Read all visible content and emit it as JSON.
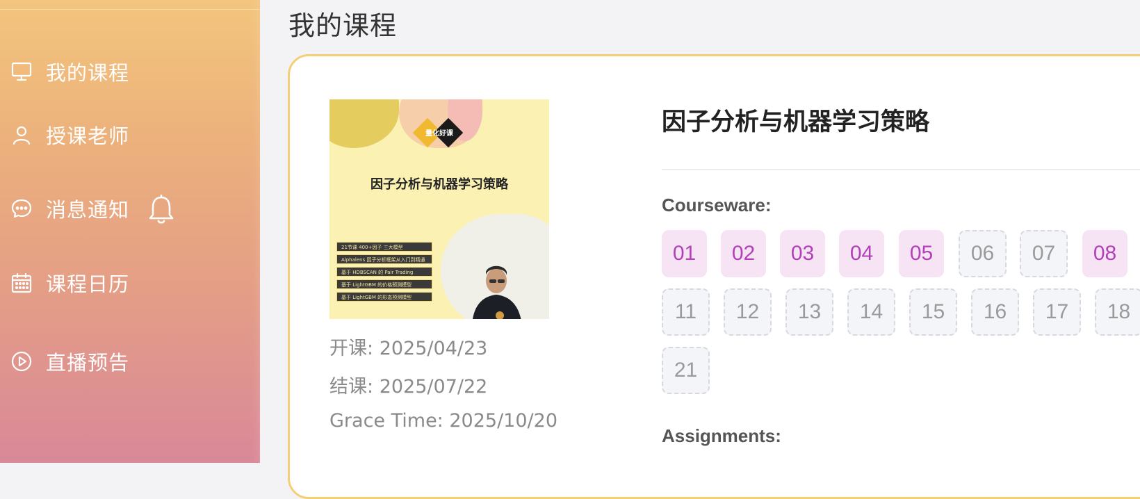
{
  "sidebar": {
    "items": [
      {
        "label": "我的课程",
        "icon": "monitor-icon"
      },
      {
        "label": "授课老师",
        "icon": "user-icon"
      },
      {
        "label": "消息通知",
        "icon": "chat-icon",
        "badge_icon": "bell-icon"
      },
      {
        "label": "课程日历",
        "icon": "calendar-icon"
      },
      {
        "label": "直播预告",
        "icon": "play-circle-icon"
      }
    ]
  },
  "page": {
    "title": "我的课程"
  },
  "course": {
    "title": "因子分析与机器学习策略",
    "cover": {
      "brand": "量化好课",
      "title": "因子分析与机器学习策略",
      "tags": [
        "21节课 400+因子 三大模型",
        "Alphalens 因子分析框架从入门到精通",
        "基于 HDBSCAN 的 Pair Trading",
        "基于 LightGBM 的价格预测模型",
        "基于 LightGBM 的形态预测模型"
      ]
    },
    "start": {
      "label": "开课:",
      "value": "2025/04/23"
    },
    "end": {
      "label": "结课:",
      "value": "2025/07/22"
    },
    "grace": {
      "label": "Grace Time:",
      "value": "2025/10/20"
    },
    "courseware_label": "Courseware:",
    "assignments_label": "Assignments:",
    "courseware": [
      {
        "n": "01",
        "available": true
      },
      {
        "n": "02",
        "available": true
      },
      {
        "n": "03",
        "available": true
      },
      {
        "n": "04",
        "available": true
      },
      {
        "n": "05",
        "available": true
      },
      {
        "n": "06",
        "available": false
      },
      {
        "n": "07",
        "available": false
      },
      {
        "n": "08",
        "available": true
      },
      {
        "n": "11",
        "available": false
      },
      {
        "n": "12",
        "available": false
      },
      {
        "n": "13",
        "available": false
      },
      {
        "n": "14",
        "available": false
      },
      {
        "n": "15",
        "available": false
      },
      {
        "n": "16",
        "available": false
      },
      {
        "n": "17",
        "available": false
      },
      {
        "n": "18",
        "available": false
      },
      {
        "n": "21",
        "available": false
      }
    ]
  },
  "colors": {
    "accent": "#b140b9",
    "available_bg": "#f6e4f4",
    "card_border": "#f4cf78"
  }
}
